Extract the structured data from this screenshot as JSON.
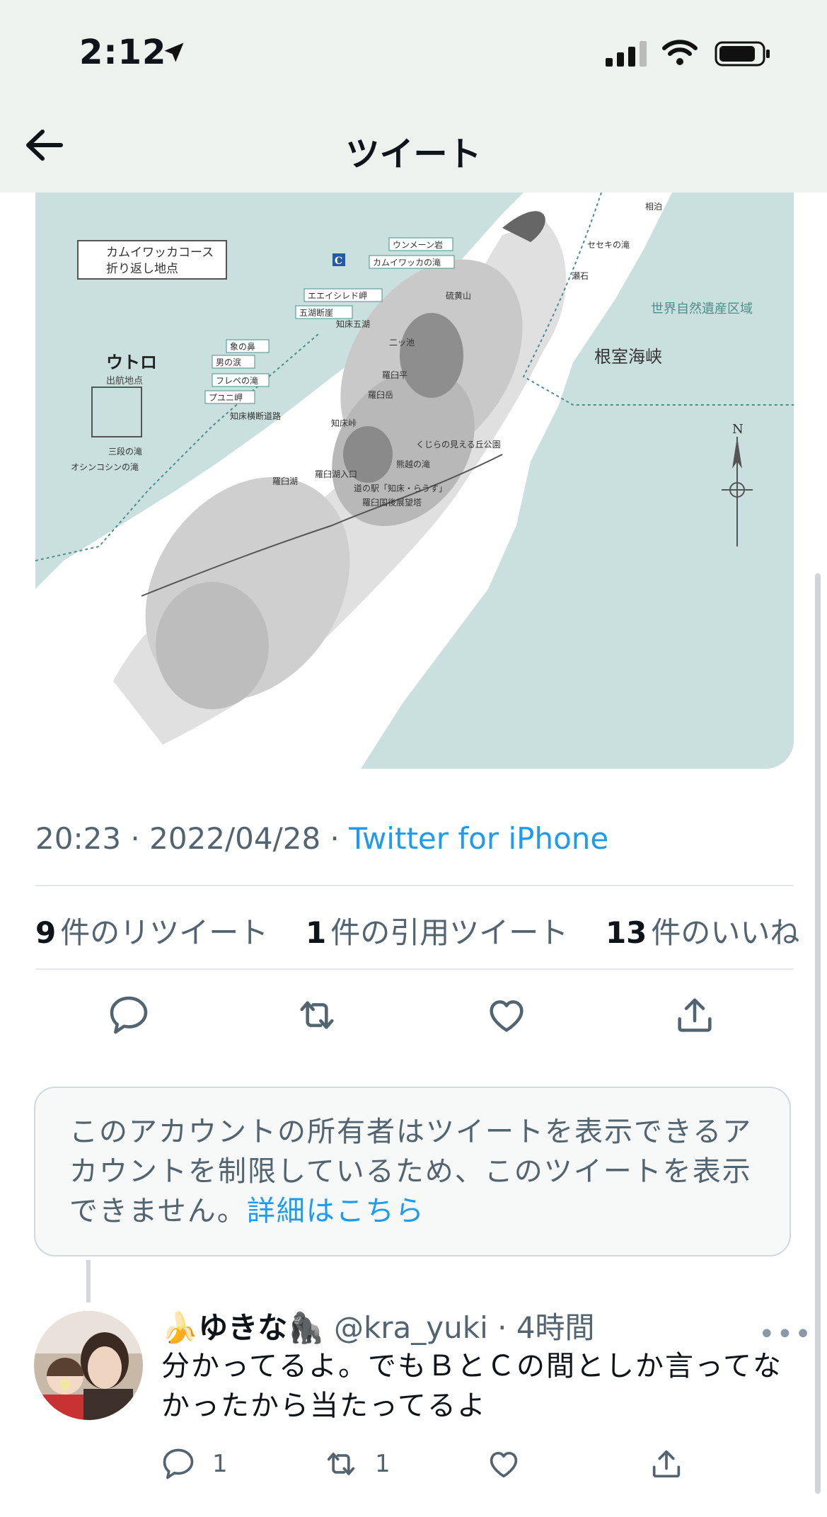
{
  "status_bar": {
    "time": "2:12"
  },
  "nav": {
    "title": "ツイート"
  },
  "map": {
    "labels": {
      "kamuiwakka_course": "カムイワッカコース",
      "turnaround": "折り返し地点",
      "utoro": "ウトロ",
      "departure": "出航地点",
      "nemuro_strait": "根室海峡",
      "heritage_area": "世界自然遺産区域",
      "north": "N",
      "marker_c": "C",
      "places": [
        "ウンメーン岩",
        "カムイワッカの滝",
        "エエイシレド岬",
        "五湖断崖",
        "知床五湖",
        "象の鼻",
        "男の涙",
        "フレペの滝",
        "プユニ岬",
        "知床横断道路",
        "知床峠",
        "三段の滝",
        "オシンコシンの滝",
        "羅臼湖",
        "羅臼湖入口",
        "熊越の滝",
        "道の駅「知床・らうす」",
        "羅臼国後展望塔",
        "くじらの見える丘公園",
        "硫黄山",
        "二ッ池",
        "羅臼平",
        "羅臼岳",
        "相泊",
        "セセキの滝",
        "瀬石"
      ]
    }
  },
  "tweet": {
    "time": "20:23",
    "date": "2022/04/28",
    "source": "Twitter for iPhone",
    "retweets_count": "9",
    "retweets_label": "件のリツイート",
    "quotes_count": "1",
    "quotes_label": "件の引用ツイート",
    "likes_count": "13",
    "likes_label": "件のいいね"
  },
  "notice": {
    "text": "このアカウントの所有者はツイートを表示できるアカウントを制限しているため、このツイートを表示できません。",
    "link": "詳細はこちら"
  },
  "reply": {
    "name": "🍌ゆきな🦍",
    "handle": "@kra_yuki",
    "time": "4時間",
    "text": "分かってるよ。でもＢとＣの間としか言ってなかったから当たってるよ",
    "reply_count": "1",
    "retweet_count": "1"
  },
  "colors": {
    "accent": "#1d9bf0",
    "sea": "#c9e0de",
    "land": "#ffffff"
  }
}
